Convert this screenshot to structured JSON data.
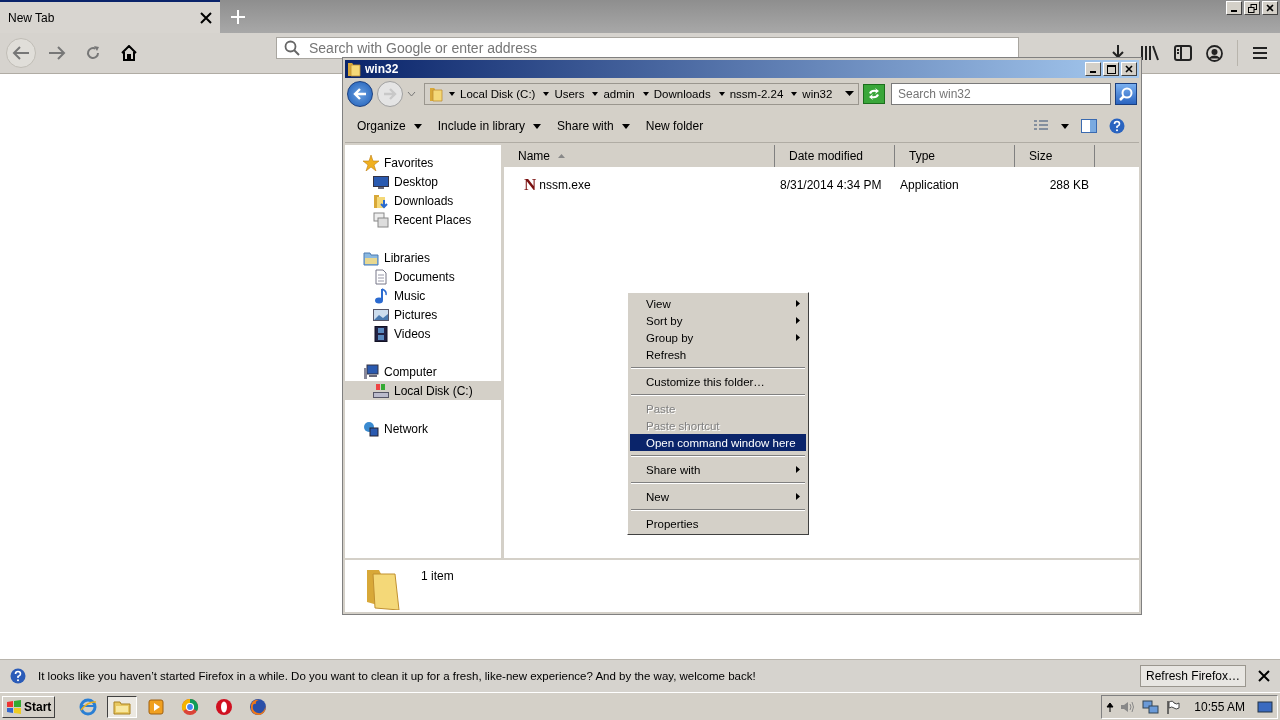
{
  "browser": {
    "tabs": [
      {
        "title": "New Tab",
        "selected": true
      }
    ],
    "address": {
      "placeholder": "Search with Google or enter address"
    }
  },
  "explorer": {
    "title": "win32",
    "breadcrumb": [
      "Local Disk (C:)",
      "Users",
      "admin",
      "Downloads",
      "nssm-2.24",
      "win32"
    ],
    "search": {
      "placeholder": "Search win32"
    },
    "toolbar": [
      {
        "label": "Organize",
        "dropdown": true
      },
      {
        "label": "Include in library",
        "dropdown": true
      },
      {
        "label": "Share with",
        "dropdown": true
      },
      {
        "label": "New folder",
        "dropdown": false
      }
    ],
    "sidebar": [
      {
        "label": "Favorites",
        "kind": "star",
        "selected": false,
        "children": [
          {
            "label": "Desktop",
            "kind": "desktop",
            "selected": false
          },
          {
            "label": "Downloads",
            "kind": "downloads",
            "selected": false
          },
          {
            "label": "Recent Places",
            "kind": "recent",
            "selected": false
          }
        ]
      },
      {
        "label": "Libraries",
        "kind": "library",
        "selected": false,
        "children": [
          {
            "label": "Documents",
            "kind": "documents",
            "selected": false
          },
          {
            "label": "Music",
            "kind": "music",
            "selected": false
          },
          {
            "label": "Pictures",
            "kind": "pictures",
            "selected": false
          },
          {
            "label": "Videos",
            "kind": "videos",
            "selected": false
          }
        ]
      },
      {
        "label": "Computer",
        "kind": "computer",
        "selected": false,
        "children": [
          {
            "label": "Local Disk (C:)",
            "kind": "drive",
            "selected": true
          }
        ]
      },
      {
        "label": "Network",
        "kind": "network",
        "selected": false
      }
    ],
    "columns": [
      {
        "label": "Name",
        "sorted": true
      },
      {
        "label": "Date modified",
        "sorted": false
      },
      {
        "label": "Type",
        "sorted": false
      },
      {
        "label": "Size",
        "sorted": false
      }
    ],
    "rows": [
      {
        "icon_text": "N",
        "name": "nssm.exe",
        "date_modified": "8/31/2014 4:34 PM",
        "type": "Application",
        "size": "288 KB"
      }
    ],
    "details": "1 item"
  },
  "context_menu": [
    [
      {
        "label": "View",
        "submenu": true,
        "disabled": false,
        "selected": false
      },
      {
        "label": "Sort by",
        "submenu": true,
        "disabled": false,
        "selected": false
      },
      {
        "label": "Group by",
        "submenu": true,
        "disabled": false,
        "selected": false
      },
      {
        "label": "Refresh",
        "submenu": false,
        "disabled": false,
        "selected": false
      }
    ],
    [
      {
        "label": "Customize this folder…",
        "submenu": false,
        "disabled": false,
        "selected": false
      }
    ],
    [
      {
        "label": "Paste",
        "submenu": false,
        "disabled": true,
        "selected": false
      },
      {
        "label": "Paste shortcut",
        "submenu": false,
        "disabled": true,
        "selected": false
      },
      {
        "label": "Open command window here",
        "submenu": false,
        "disabled": false,
        "selected": true
      }
    ],
    [
      {
        "label": "Share with",
        "submenu": true,
        "disabled": false,
        "selected": false
      }
    ],
    [
      {
        "label": "New",
        "submenu": true,
        "disabled": false,
        "selected": false
      }
    ],
    [
      {
        "label": "Properties",
        "submenu": false,
        "disabled": false,
        "selected": false
      }
    ]
  ],
  "notification": {
    "text": "It looks like you haven’t started Firefox in a while. Do you want to clean it up for a fresh, like-new experience? And by the way, welcome back!",
    "button": "Refresh Firefox…"
  },
  "taskbar": {
    "start": "Start",
    "apps": [
      {
        "kind": "globe",
        "selected": false
      },
      {
        "kind": "folder",
        "selected": true
      },
      {
        "kind": "player",
        "selected": false
      },
      {
        "kind": "ring",
        "selected": false
      },
      {
        "kind": "disc",
        "selected": false
      },
      {
        "kind": "fox",
        "selected": false
      }
    ],
    "clock": "10:55 AM"
  }
}
